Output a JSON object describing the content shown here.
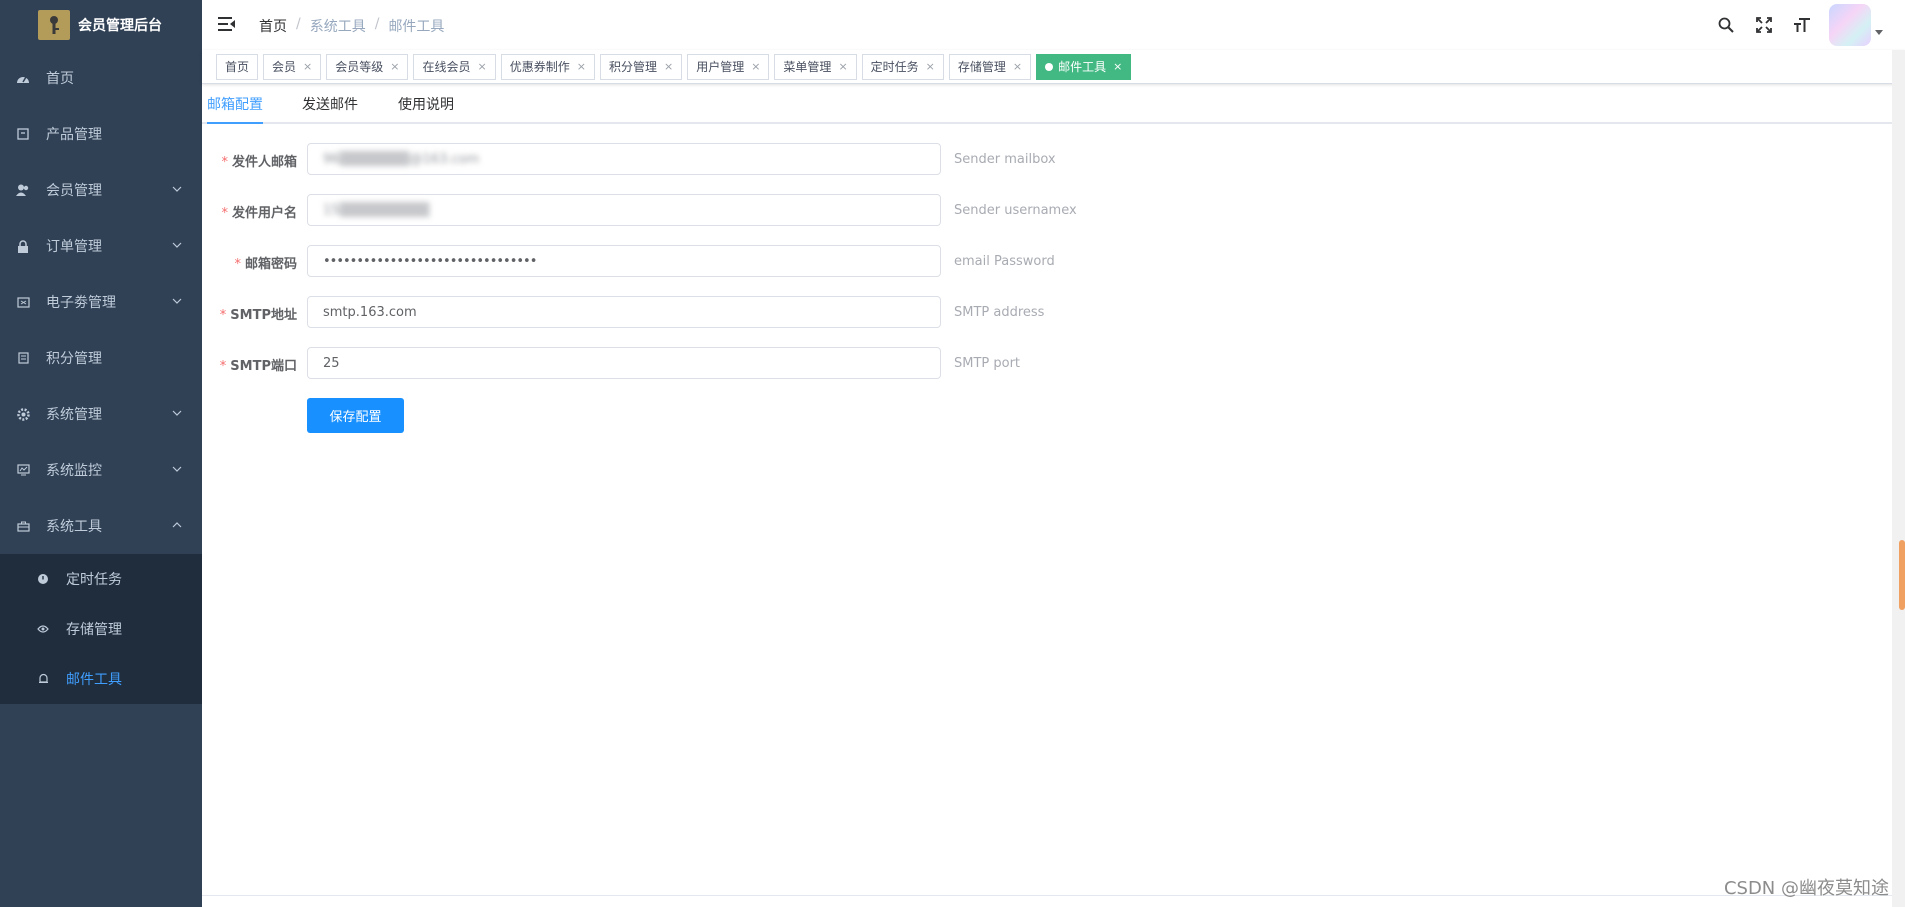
{
  "app": {
    "title": "会员管理后台"
  },
  "sidebar": {
    "items": [
      {
        "label": "首页",
        "icon": "dashboard-icon"
      },
      {
        "label": "产品管理",
        "icon": "product-icon"
      },
      {
        "label": "会员管理",
        "icon": "user-icon"
      },
      {
        "label": "订单管理",
        "icon": "lock-icon"
      },
      {
        "label": "电子劵管理",
        "icon": "coupon-icon"
      },
      {
        "label": "积分管理",
        "icon": "points-icon"
      },
      {
        "label": "系统管理",
        "icon": "gear-icon"
      },
      {
        "label": "系统监控",
        "icon": "monitor-icon"
      },
      {
        "label": "系统工具",
        "icon": "toolbox-icon"
      }
    ],
    "subitems": [
      {
        "label": "定时任务",
        "icon": "timer-icon"
      },
      {
        "label": "存储管理",
        "icon": "storage-icon"
      },
      {
        "label": "邮件工具",
        "icon": "bell-icon",
        "active": true
      }
    ]
  },
  "header": {
    "breadcrumb": [
      "首页",
      "系统工具",
      "邮件工具"
    ],
    "breadcrumb_sep": "/"
  },
  "tags": [
    {
      "label": "首页",
      "closable": false
    },
    {
      "label": "会员",
      "closable": true
    },
    {
      "label": "会员等级",
      "closable": true
    },
    {
      "label": "在线会员",
      "closable": true
    },
    {
      "label": "优惠券制作",
      "closable": true
    },
    {
      "label": "积分管理",
      "closable": true
    },
    {
      "label": "用户管理",
      "closable": true
    },
    {
      "label": "菜单管理",
      "closable": true
    },
    {
      "label": "定时任务",
      "closable": true
    },
    {
      "label": "存储管理",
      "closable": true
    },
    {
      "label": "邮件工具",
      "closable": true,
      "active": true
    }
  ],
  "tag_close": "×",
  "subtabs": [
    "邮箱配置",
    "发送邮件",
    "使用说明"
  ],
  "form": {
    "fields": [
      {
        "label": "发件人邮箱",
        "value": "96▒▒▒▒▒▒▒@163.com",
        "hint": "Sender mailbox"
      },
      {
        "label": "发件用户名",
        "value": "15▒▒▒▒▒▒▒▒▒",
        "hint": "Sender usernamex"
      },
      {
        "label": "邮箱密码",
        "value": "••••••••••••••••••••••••••••••••",
        "hint": "email Password"
      },
      {
        "label": "SMTP地址",
        "value": "smtp.163.com",
        "hint": "SMTP address"
      },
      {
        "label": "SMTP端口",
        "value": "25",
        "hint": "SMTP port"
      }
    ],
    "required_mark": "*",
    "save_label": "保存配置"
  },
  "watermark": "CSDN @幽夜莫知途",
  "colors": {
    "sidebar_bg": "#304156",
    "submenu_bg": "#1f2d3d",
    "primary": "#409eff",
    "tag_active": "#42b983",
    "button": "#1890ff"
  }
}
